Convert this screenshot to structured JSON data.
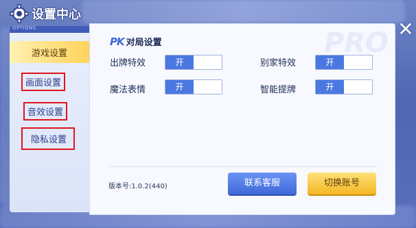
{
  "window": {
    "title": "设置中心",
    "options_label": "OPTIONS",
    "close_label": "✕"
  },
  "sidebar": {
    "items": [
      {
        "label": "游戏设置",
        "active": true,
        "highlighted": false
      },
      {
        "label": "画面设置",
        "active": false,
        "highlighted": true
      },
      {
        "label": "音效设置",
        "active": false,
        "highlighted": true
      },
      {
        "label": "隐私设置",
        "active": false,
        "highlighted": true
      }
    ]
  },
  "section": {
    "icon_text": "PK",
    "title": "对局设置",
    "watermark": "PRO"
  },
  "settings": [
    {
      "label": "出牌特效",
      "toggle": "开"
    },
    {
      "label": "别家特效",
      "toggle": "开"
    },
    {
      "label": "魔法表情",
      "toggle": "开"
    },
    {
      "label": "智能提牌",
      "toggle": "开"
    }
  ],
  "footer": {
    "version": "版本号:1.0.2(440)",
    "contact_button": "联系客服",
    "switch_account_button": "切换账号"
  },
  "colors": {
    "active_tab": "#ffd35c",
    "toggle_on": "#4b78e0",
    "highlight_box": "#e0141c",
    "primary_button": "#3f68d9",
    "secondary_button": "#f4b624"
  }
}
